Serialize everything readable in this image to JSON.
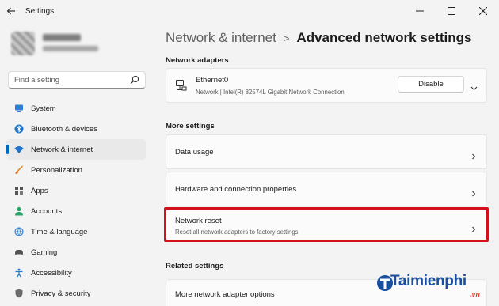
{
  "window": {
    "title": "Settings",
    "back_icon": "back-arrow-icon",
    "controls": [
      "minimize-icon",
      "maximize-icon",
      "close-icon"
    ]
  },
  "sidebar": {
    "profile": {
      "name": "blurred",
      "email": "blurred"
    },
    "search": {
      "placeholder": "Find a setting",
      "icon": "search-icon"
    },
    "items": [
      {
        "label": "System",
        "icon": "monitor-icon"
      },
      {
        "label": "Bluetooth & devices",
        "icon": "bluetooth-icon"
      },
      {
        "label": "Network & internet",
        "icon": "wifi-icon",
        "active": true
      },
      {
        "label": "Personalization",
        "icon": "brush-icon"
      },
      {
        "label": "Apps",
        "icon": "apps-grid-icon"
      },
      {
        "label": "Accounts",
        "icon": "person-icon"
      },
      {
        "label": "Time & language",
        "icon": "globe-clock-icon"
      },
      {
        "label": "Gaming",
        "icon": "gamepad-icon"
      },
      {
        "label": "Accessibility",
        "icon": "accessibility-icon"
      },
      {
        "label": "Privacy & security",
        "icon": "shield-icon"
      }
    ]
  },
  "main": {
    "breadcrumb": {
      "parent": "Network & internet",
      "separator": ">",
      "current": "Advanced network settings"
    },
    "network_adapters": {
      "title": "Network adapters",
      "adapter": {
        "name": "Ethernet0",
        "details": "Network | Intel(R) 82574L Gigabit Network Connection",
        "button": "Disable"
      }
    },
    "more_settings": {
      "title": "More settings",
      "items": [
        {
          "label": "Data usage"
        },
        {
          "label": "Hardware and connection properties"
        },
        {
          "label": "Network reset",
          "sublabel": "Reset all network adapters to factory settings",
          "highlighted": true
        }
      ]
    },
    "related_settings": {
      "title": "Related settings",
      "items": [
        {
          "label": "More network adapter options"
        }
      ]
    }
  },
  "watermark": {
    "brand": "Taimienphi",
    "suffix": ".vn"
  },
  "colors": {
    "accent": "#0067c0",
    "highlight": "#d3111c",
    "watermark": "#1a4fa0"
  }
}
